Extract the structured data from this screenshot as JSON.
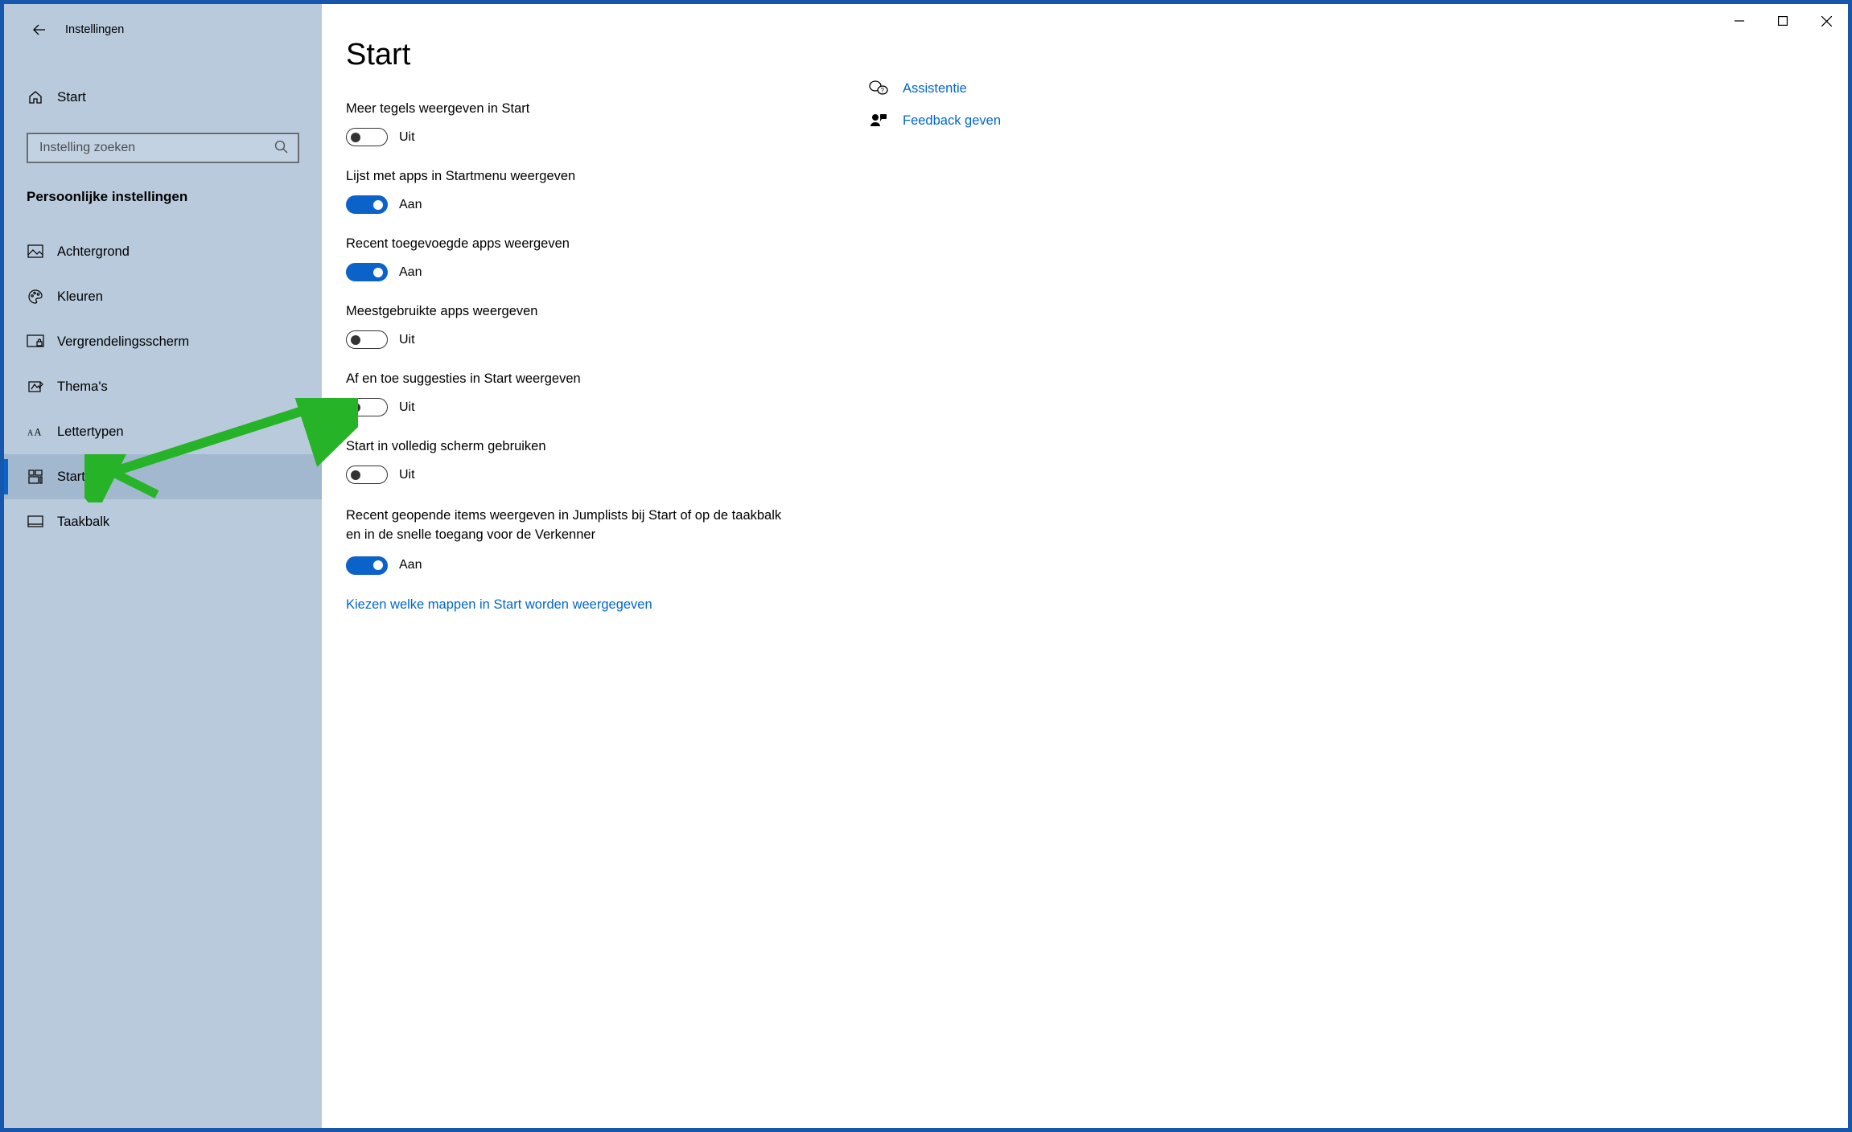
{
  "window": {
    "title": "Instellingen"
  },
  "sidebar": {
    "home_label": "Start",
    "search_placeholder": "Instelling zoeken",
    "category": "Persoonlijke instellingen",
    "items": [
      {
        "id": "background",
        "label": "Achtergrond"
      },
      {
        "id": "colors",
        "label": "Kleuren"
      },
      {
        "id": "lockscreen",
        "label": "Vergrendelingsscherm"
      },
      {
        "id": "themes",
        "label": "Thema's"
      },
      {
        "id": "fonts",
        "label": "Lettertypen"
      },
      {
        "id": "start",
        "label": "Start"
      },
      {
        "id": "taskbar",
        "label": "Taakbalk"
      }
    ]
  },
  "page": {
    "title": "Start",
    "toggles": [
      {
        "label": "Meer tegels weergeven in Start",
        "on": false
      },
      {
        "label": "Lijst met apps in Startmenu weergeven",
        "on": true
      },
      {
        "label": "Recent toegevoegde apps weergeven",
        "on": true
      },
      {
        "label": "Meestgebruikte apps weergeven",
        "on": false
      },
      {
        "label": "Af en toe suggesties in Start weergeven",
        "on": false
      },
      {
        "label": "Start in volledig scherm gebruiken",
        "on": false
      },
      {
        "label": "Recent geopende items weergeven in Jumplists bij Start of op de taakbalk en in de snelle toegang voor de Verkenner",
        "on": true
      }
    ],
    "state_on": "Aan",
    "state_off": "Uit",
    "link": "Kiezen welke mappen in Start worden weergegeven"
  },
  "side_links": [
    {
      "id": "help",
      "label": "Assistentie"
    },
    {
      "id": "feedback",
      "label": "Feedback geven"
    }
  ]
}
